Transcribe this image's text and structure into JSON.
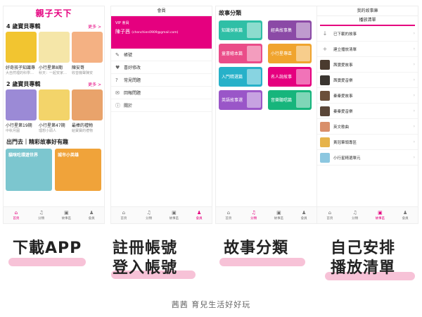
{
  "phone1": {
    "logo": "親子天下",
    "section1": {
      "title": "4 歲寶貝專輯",
      "more": "更多 >"
    },
    "cards1": [
      {
        "title": "好奇孩子知識專",
        "sub": "大自然裡的科學…",
        "color": "#f2c530"
      },
      {
        "title": "小行星第8期",
        "sub": "秋天：一起安家…",
        "color": "#f5e6a8"
      },
      {
        "title": "陳安哥",
        "sub": "收音機聲陳安",
        "color": "#f4b183"
      }
    ],
    "section2": {
      "title": "2 歲寶貝專輯",
      "more": "更多 >"
    },
    "cards2": [
      {
        "title": "小行星第19期",
        "sub": "中秋月圓",
        "color": "#9b8ad6"
      },
      {
        "title": "小行星第47期",
        "sub": "理想小頭人",
        "color": "#f3d46a"
      },
      {
        "title": "最棒的禮物",
        "sub": "給寶寶的禮物",
        "color": "#e9a36b"
      }
    ],
    "section3": {
      "title": "出門去｜精彩故事好有趣"
    },
    "big_cards": [
      {
        "label": "貓咪吃環遊世界",
        "color": "#7cc6cf"
      },
      {
        "label": "城市小英雄",
        "color": "#f0a33a"
      }
    ],
    "tabs": [
      "首頁",
      "分類",
      "故事區",
      "會員"
    ],
    "tab_icons": [
      "⌂",
      "♫",
      "▣",
      "♟"
    ]
  },
  "phone2": {
    "topbar": "會員",
    "vip_label": "VIP 會員",
    "vip_name": "陳子茜",
    "vip_email": "chenchien0909@gmail.com",
    "menu": [
      {
        "icon": "✎",
        "label": "帳號"
      },
      {
        "icon": "♥",
        "label": "喜好修改"
      },
      {
        "icon": "?",
        "label": "常見問題"
      },
      {
        "icon": "✉",
        "label": "回報問題"
      },
      {
        "icon": "ⓘ",
        "label": "關於"
      }
    ],
    "tabs": [
      "首頁",
      "分類",
      "故事區",
      "會員"
    ],
    "tab_icons": [
      "⌂",
      "♫",
      "▣",
      "♟"
    ]
  },
  "phone3": {
    "title": "故事分類",
    "categories": [
      {
        "label": "知識探索篇",
        "color": "#2fbfa6"
      },
      {
        "label": "經典故事集",
        "color": "#8b4aa6"
      },
      {
        "label": "童書繪本篇",
        "color": "#ea4d89"
      },
      {
        "label": "小行星專區",
        "color": "#f0a42e"
      },
      {
        "label": "入門精選篇",
        "color": "#27b1c9"
      },
      {
        "label": "名人說故事",
        "color": "#e5007f"
      },
      {
        "label": "英語故事選",
        "color": "#9a56c8"
      },
      {
        "label": "音樂聽唱篇",
        "color": "#17b57c"
      }
    ],
    "tabs": [
      "首頁",
      "分類",
      "故事區",
      "會員"
    ],
    "tab_icons": [
      "⌂",
      "♫",
      "▣",
      "♟"
    ]
  },
  "phone4": {
    "topbar": "我的故事庫",
    "tab": "播放清單",
    "items": [
      {
        "label": "已下載的故事",
        "icon": "↓"
      },
      {
        "label": "建立播放清單",
        "icon": "+"
      },
      {
        "label": "茜寶愛故事",
        "color": "#4a3b2f"
      },
      {
        "label": "茜寶愛音樂",
        "color": "#3a3530"
      },
      {
        "label": "秦秦愛故事",
        "color": "#6b4f3a"
      },
      {
        "label": "秦秦愛音樂",
        "color": "#5a4638"
      },
      {
        "label": "英文歌曲",
        "color": "#d98f6a"
      },
      {
        "label": "黃冠筆頭專區",
        "color": "#e6b34a"
      },
      {
        "label": "小行星精選單元",
        "color": "#8cc7e0"
      }
    ],
    "tabs": [
      "首頁",
      "分類",
      "故事區",
      "會員"
    ],
    "tab_icons": [
      "⌂",
      "♫",
      "▣",
      "♟"
    ]
  },
  "captions": [
    "下載APP",
    "註冊帳號",
    "登入帳號",
    "故事分類",
    "自己安排",
    "播放清單"
  ],
  "footer": "茜茜 育兒生活好好玩",
  "accent": "#e5007f",
  "highlight": "#f7c2d7"
}
